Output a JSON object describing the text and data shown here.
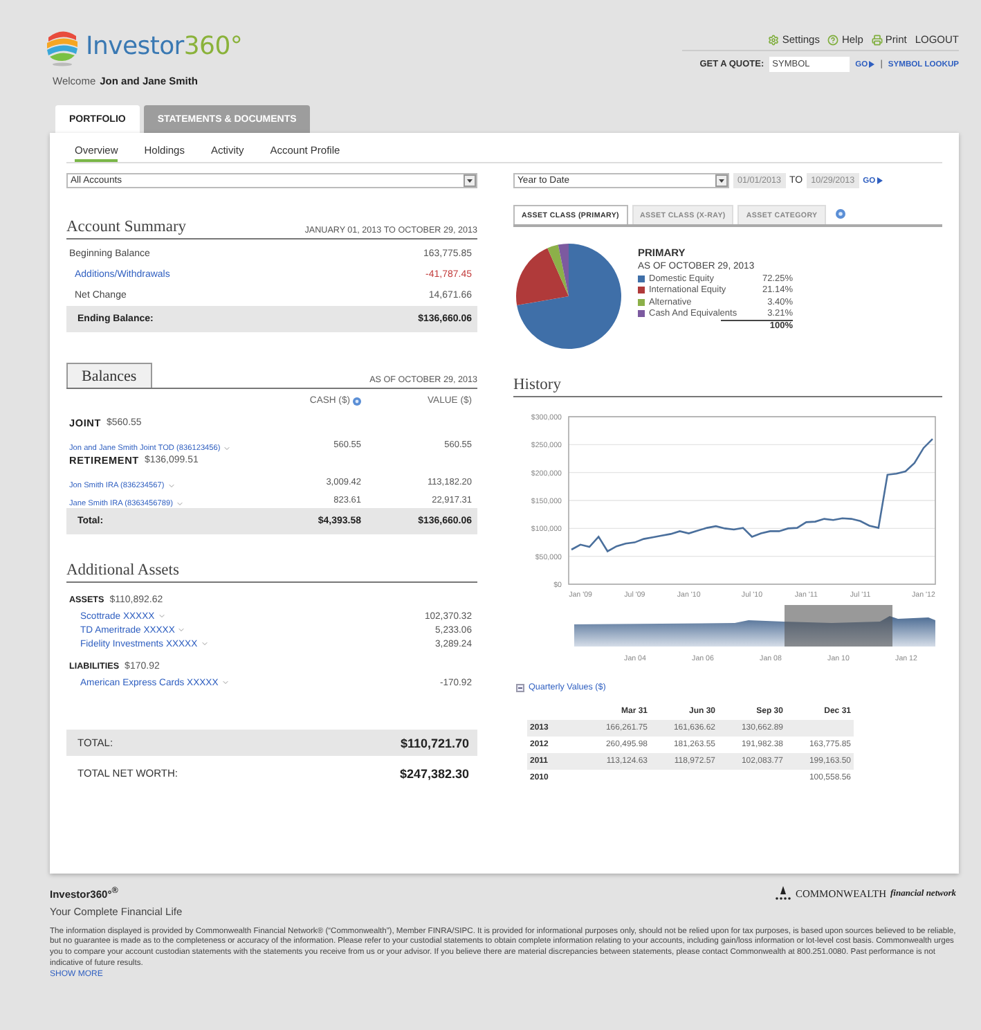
{
  "header": {
    "logo": {
      "name": "Investor",
      "suffix": "360°"
    },
    "welcome": {
      "prefix": "Welcome",
      "name": "Jon and Jane Smith"
    },
    "utility_links": [
      {
        "kind": "settings",
        "label": "Settings"
      },
      {
        "kind": "help",
        "label": "Help"
      },
      {
        "kind": "print",
        "label": "Print"
      },
      {
        "kind": "plain",
        "label": "LOGOUT"
      }
    ],
    "quote": {
      "label": "GET A QUOTE:",
      "value": "SYMBOL",
      "go": "GO",
      "separator": "|",
      "lookup": "SYMBOL LOOKUP"
    }
  },
  "tabs": [
    {
      "label": "PORTFOLIO",
      "selected": true
    },
    {
      "label": "STATEMENTS & DOCUMENTS",
      "selected": false
    }
  ],
  "subnav": [
    {
      "label": "Overview",
      "selected": true
    },
    {
      "label": "Holdings",
      "selected": false
    },
    {
      "label": "Activity",
      "selected": false
    },
    {
      "label": "Account Profile",
      "selected": false
    }
  ],
  "accounts_select": "All Accounts",
  "summary": {
    "title": "Account Summary",
    "range": "JANUARY 01, 2013 TO OCTOBER 29, 2013",
    "rows": [
      {
        "label": "Beginning Balance",
        "value": "163,775.85",
        "kind": "plain",
        "negative": false
      },
      {
        "label": "Additions/Withdrawals",
        "value": "-41,787.45",
        "kind": "link",
        "negative": true
      },
      {
        "label": "Net Change",
        "value": "14,671.66",
        "kind": "sub",
        "negative": false
      },
      {
        "label": "Ending Balance:",
        "value": "$136,660.06",
        "kind": "total",
        "negative": false
      }
    ]
  },
  "balances": {
    "tab": "Balances",
    "as_of": "AS OF OCTOBER 29, 2013",
    "columns": [
      "CASH ($)",
      "VALUE ($)"
    ],
    "groups": [
      {
        "name": "JOINT",
        "amount": "$560.55",
        "accounts": [
          {
            "name": "Jon and Jane Smith Joint TOD (836123456)",
            "cash": "560.55",
            "value": "560.55"
          }
        ]
      },
      {
        "name": "RETIREMENT",
        "amount": "$136,099.51",
        "accounts": [
          {
            "name": "Jon Smith IRA (836234567)",
            "cash": "3,009.42",
            "value": "113,182.20"
          },
          {
            "name": "Jane Smith IRA (8363456789)",
            "cash": "823.61",
            "value": "22,917.31"
          }
        ]
      }
    ],
    "total": {
      "label": "Total:",
      "cash": "$4,393.58",
      "value": "$136,660.06"
    }
  },
  "additional": {
    "title": "Additional Assets",
    "groups": [
      {
        "name": "ASSETS",
        "amount": "$110,892.62",
        "accounts": [
          {
            "name": "Scottrade XXXXX",
            "value": "102,370.32"
          },
          {
            "name": "TD Ameritrade XXXXX",
            "value": "5,233.06"
          },
          {
            "name": "Fidelity Investments XXXXX",
            "value": "3,289.24"
          }
        ]
      },
      {
        "name": "LIABILITIES",
        "amount": "$170.92",
        "accounts": [
          {
            "name": "American Express Cards XXXXX",
            "value": "-170.92"
          }
        ]
      }
    ],
    "total": {
      "label": "TOTAL:",
      "value": "$110,721.70"
    },
    "net_worth": {
      "label": "TOTAL NET WORTH:",
      "value": "$247,382.30"
    }
  },
  "period": {
    "select": "Year to Date",
    "from": "01/01/2013",
    "to_label": "TO",
    "to": "10/29/2013",
    "go": "GO"
  },
  "allocation_tabs": [
    {
      "label": "ASSET CLASS (PRIMARY)",
      "selected": true
    },
    {
      "label": "ASSET CLASS (X-RAY)",
      "selected": false
    },
    {
      "label": "ASSET CATEGORY",
      "selected": false
    }
  ],
  "allocation": {
    "title": "PRIMARY",
    "as_of": "AS OF OCTOBER 29, 2013",
    "legend": [
      {
        "name": "Domestic Equity",
        "percent": "72.25%",
        "color": "#3f6fa8"
      },
      {
        "name": "International Equity",
        "percent": "21.14%",
        "color": "#b03a3a"
      },
      {
        "name": "Alternative",
        "percent": "3.40%",
        "color": "#8cb049"
      },
      {
        "name": "Cash And Equivalents",
        "percent": "3.21%",
        "color": "#7c5aa0"
      }
    ],
    "total": "100%",
    "chart_data": {
      "type": "pie",
      "values": [
        72.25,
        21.14,
        3.4,
        3.21
      ]
    }
  },
  "history": {
    "title": "History",
    "chart_data": {
      "type": "line",
      "categories": [
        null,
        "Jan '09",
        null,
        null,
        null,
        null,
        null,
        "Jul '09",
        null,
        null,
        null,
        null,
        null,
        "Jan '10",
        null,
        null,
        null,
        null,
        null,
        null,
        "Jul '10",
        null,
        null,
        null,
        null,
        null,
        "Jan '11",
        null,
        null,
        null,
        null,
        null,
        "Jul '11",
        null,
        null,
        null,
        null,
        null,
        null,
        "Jan '12",
        null
      ],
      "series": [
        {
          "color": "#4a6f9c",
          "values": [
            62000,
            71000,
            67000,
            85000,
            59000,
            68000,
            73000,
            75000,
            81000,
            84000,
            87000,
            90000,
            95000,
            91000,
            96000,
            101000,
            104000,
            100000,
            98000,
            101000,
            85000,
            91000,
            95000,
            95000,
            100000,
            101000,
            111000,
            112000,
            117000,
            115000,
            118000,
            117000,
            113000,
            105000,
            101000,
            196000,
            198000,
            202000,
            217000,
            244000,
            260000
          ]
        }
      ],
      "ylim": [
        0,
        300000
      ],
      "grid": true,
      "yticks": [
        {
          "value": 0,
          "label": "$0"
        },
        {
          "value": 50000,
          "label": "$50,000"
        },
        {
          "value": 100000,
          "label": "$100,000"
        },
        {
          "value": 150000,
          "label": "$150,000"
        },
        {
          "value": 200000,
          "label": "$200,000"
        },
        {
          "value": 250000,
          "label": "$250,000"
        },
        {
          "value": 300000,
          "label": "$300,000"
        }
      ]
    }
  },
  "navigator": {
    "labels": [
      "Jan 04",
      "Jan 06",
      "Jan 08",
      "Jan 10",
      "Jan 12"
    ]
  },
  "quarterly": {
    "toggle": "Quarterly Values ($)",
    "expanded": true,
    "columns": [
      "Mar 31",
      "Jun 30",
      "Sep 30",
      "Dec 31"
    ],
    "rows": [
      {
        "year": "2013",
        "cells": [
          "166,261.75",
          "161,636.62",
          "130,662.89",
          null
        ]
      },
      {
        "year": "2012",
        "cells": [
          "260,495.98",
          "181,263.55",
          "191,982.38",
          "163,775.85"
        ]
      },
      {
        "year": "2011",
        "cells": [
          "113,124.63",
          "118,972.57",
          "102,083.77",
          "199,163.50"
        ]
      },
      {
        "year": "2010",
        "cells": [
          null,
          null,
          null,
          "100,558.56"
        ]
      }
    ]
  },
  "footer": {
    "brand": "Investor360°$^{®}$",
    "tagline": "Your Complete Financial Life",
    "disclaimer": "The information displayed is provided by Commonwealth Financial Network® (“Commonwealth”), Member FINRA/SIPC. It is provided for informational purposes only, should not be relied upon for tax purposes, is based upon sources believed to be reliable, but no guarantee is made as to the completeness or accuracy of the information. Please refer to your custodial statements to obtain complete information relating to your accounts, including gain/loss information or lot-level cost basis. Commonwealth urges you to compare your account custodian statements with the statements you receive from us or your advisor. If you believe there are material discrepancies between statements, please contact Commonwealth at 800.251.0080. Past performance is not indicative of future results.",
    "show_more": "SHOW MORE",
    "partner": {
      "name": "COMMONWEALTH",
      "tagline": "financial network"
    }
  }
}
